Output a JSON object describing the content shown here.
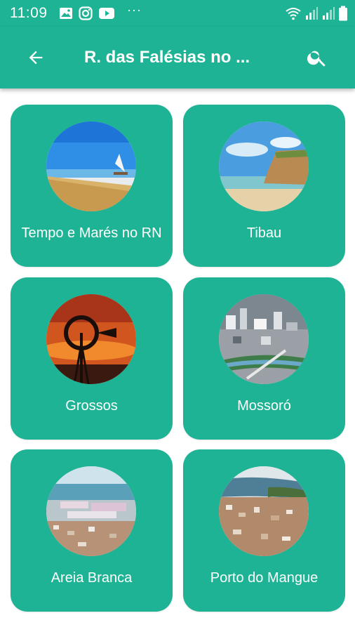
{
  "status_bar": {
    "time": "11:09",
    "icons_left": [
      "image-icon",
      "instagram-icon",
      "youtube-icon"
    ],
    "more": "···",
    "icons_right": [
      "wifi-icon",
      "signal-icon",
      "signal-icon",
      "battery-icon"
    ]
  },
  "app_bar": {
    "title": "R. das Falésias no ...",
    "back_icon": "arrow-back-icon",
    "search_icon": "search-icon"
  },
  "colors": {
    "primary": "#1db394",
    "card_text": "#ffffff"
  },
  "cards": [
    {
      "label": "Tempo e Marés no RN",
      "image": "beach-sailboat"
    },
    {
      "label": "Tibau",
      "image": "cliff-coast"
    },
    {
      "label": "Grossos",
      "image": "windmill-sunset"
    },
    {
      "label": "Mossoró",
      "image": "city-aerial"
    },
    {
      "label": "Areia Branca",
      "image": "salt-pans-aerial"
    },
    {
      "label": "Porto do Mangue",
      "image": "town-lagoon-aerial"
    }
  ]
}
